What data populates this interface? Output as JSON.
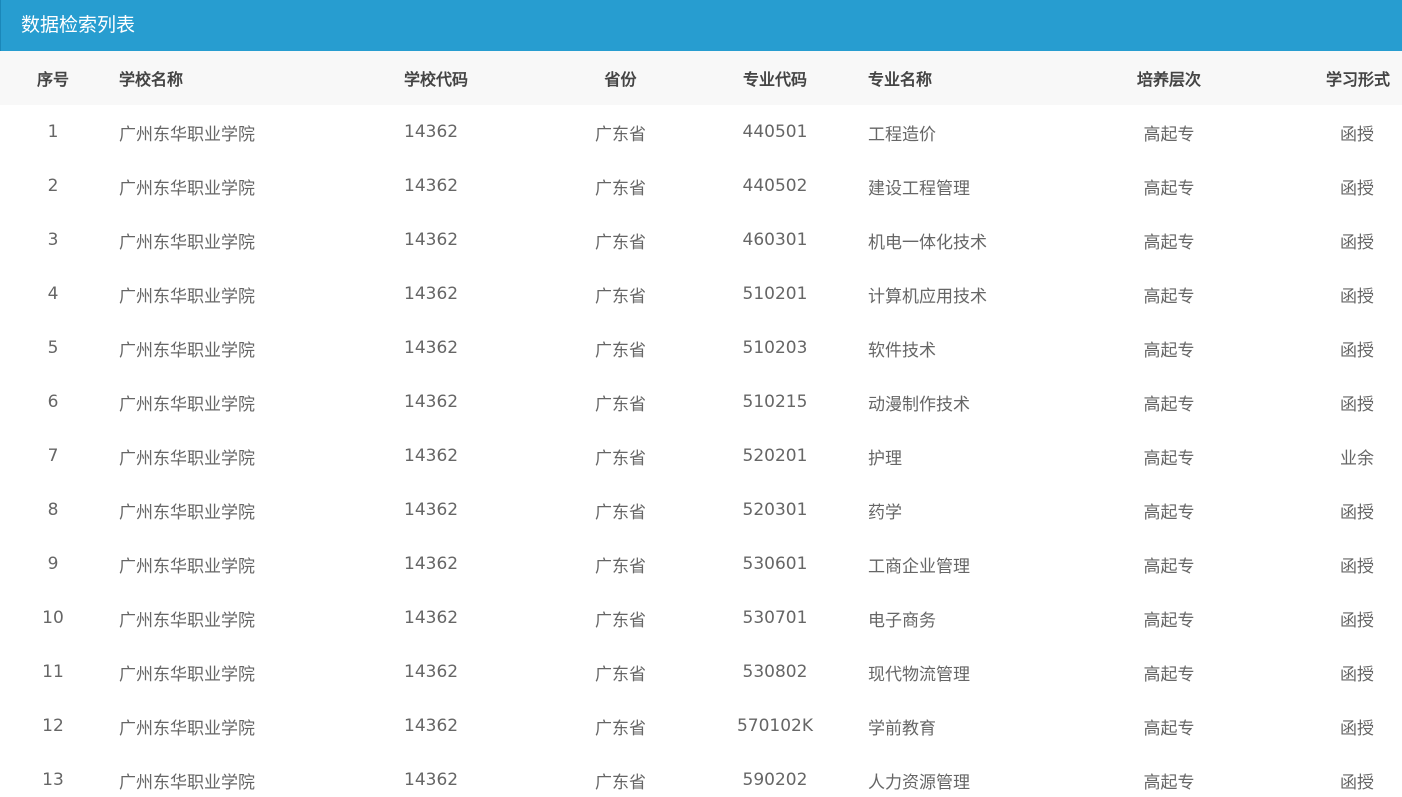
{
  "panel": {
    "title": "数据检索列表"
  },
  "table": {
    "headers": {
      "no": "序号",
      "school_name": "学校名称",
      "school_code": "学校代码",
      "province": "省份",
      "major_code": "专业代码",
      "major_name": "专业名称",
      "level": "培养层次",
      "study_form": "学习形式"
    },
    "rows": [
      {
        "no": "1",
        "school_name": "广州东华职业学院",
        "school_code": "14362",
        "province": "广东省",
        "major_code": "440501",
        "major_name": "工程造价",
        "level": "高起专",
        "study_form": "函授"
      },
      {
        "no": "2",
        "school_name": "广州东华职业学院",
        "school_code": "14362",
        "province": "广东省",
        "major_code": "440502",
        "major_name": "建设工程管理",
        "level": "高起专",
        "study_form": "函授"
      },
      {
        "no": "3",
        "school_name": "广州东华职业学院",
        "school_code": "14362",
        "province": "广东省",
        "major_code": "460301",
        "major_name": "机电一体化技术",
        "level": "高起专",
        "study_form": "函授"
      },
      {
        "no": "4",
        "school_name": "广州东华职业学院",
        "school_code": "14362",
        "province": "广东省",
        "major_code": "510201",
        "major_name": "计算机应用技术",
        "level": "高起专",
        "study_form": "函授"
      },
      {
        "no": "5",
        "school_name": "广州东华职业学院",
        "school_code": "14362",
        "province": "广东省",
        "major_code": "510203",
        "major_name": "软件技术",
        "level": "高起专",
        "study_form": "函授"
      },
      {
        "no": "6",
        "school_name": "广州东华职业学院",
        "school_code": "14362",
        "province": "广东省",
        "major_code": "510215",
        "major_name": "动漫制作技术",
        "level": "高起专",
        "study_form": "函授"
      },
      {
        "no": "7",
        "school_name": "广州东华职业学院",
        "school_code": "14362",
        "province": "广东省",
        "major_code": "520201",
        "major_name": "护理",
        "level": "高起专",
        "study_form": "业余"
      },
      {
        "no": "8",
        "school_name": "广州东华职业学院",
        "school_code": "14362",
        "province": "广东省",
        "major_code": "520301",
        "major_name": "药学",
        "level": "高起专",
        "study_form": "函授"
      },
      {
        "no": "9",
        "school_name": "广州东华职业学院",
        "school_code": "14362",
        "province": "广东省",
        "major_code": "530601",
        "major_name": "工商企业管理",
        "level": "高起专",
        "study_form": "函授"
      },
      {
        "no": "10",
        "school_name": "广州东华职业学院",
        "school_code": "14362",
        "province": "广东省",
        "major_code": "530701",
        "major_name": "电子商务",
        "level": "高起专",
        "study_form": "函授"
      },
      {
        "no": "11",
        "school_name": "广州东华职业学院",
        "school_code": "14362",
        "province": "广东省",
        "major_code": "530802",
        "major_name": "现代物流管理",
        "level": "高起专",
        "study_form": "函授"
      },
      {
        "no": "12",
        "school_name": "广州东华职业学院",
        "school_code": "14362",
        "province": "广东省",
        "major_code": "570102K",
        "major_name": "学前教育",
        "level": "高起专",
        "study_form": "函授"
      },
      {
        "no": "13",
        "school_name": "广州东华职业学院",
        "school_code": "14362",
        "province": "广东省",
        "major_code": "590202",
        "major_name": "人力资源管理",
        "level": "高起专",
        "study_form": "函授"
      }
    ]
  },
  "colors": {
    "header_bar": "#279dd0",
    "table_head_bg": "#f8f8f8",
    "cell_text": "#666666",
    "head_text": "#444444"
  }
}
